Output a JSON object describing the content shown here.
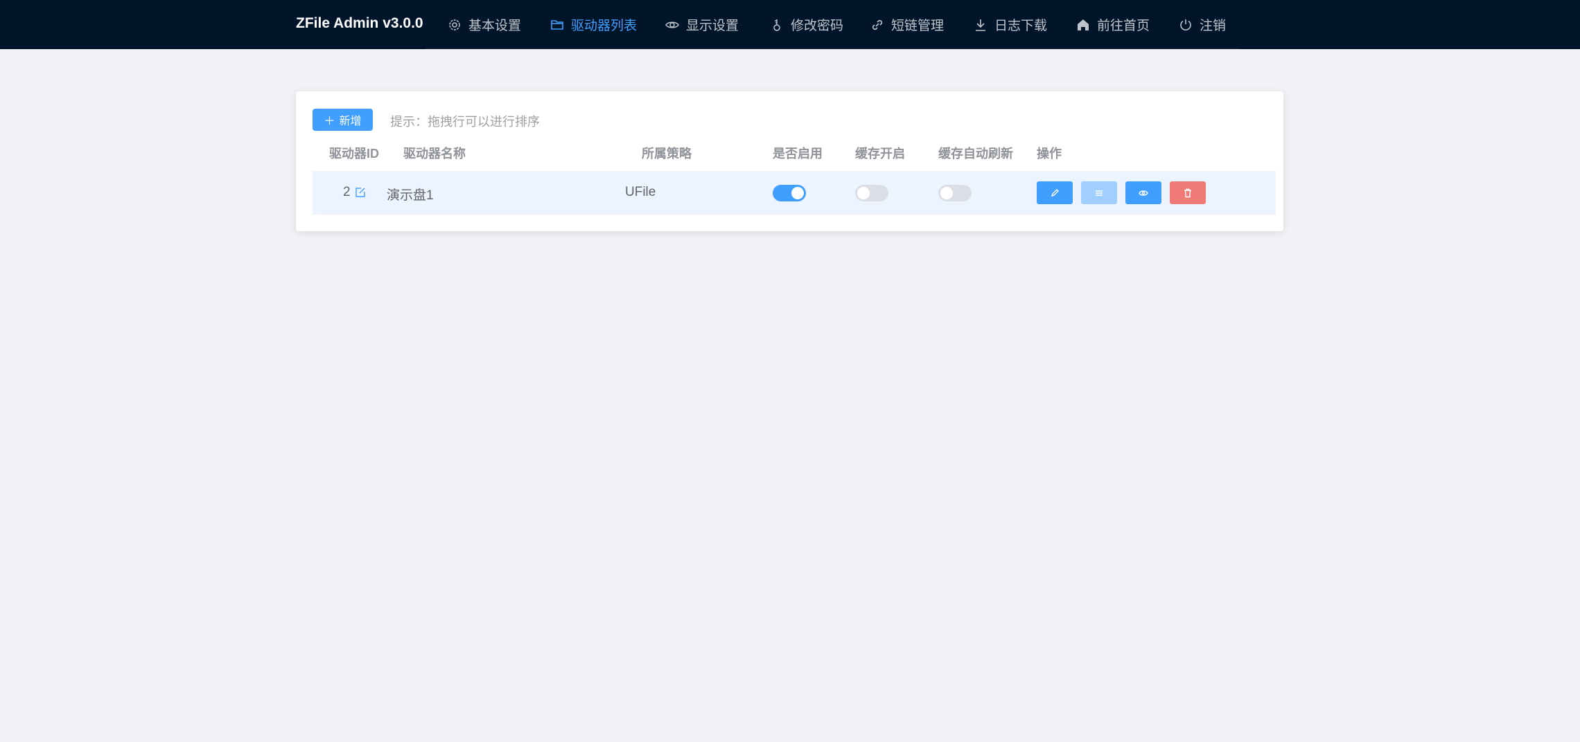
{
  "header": {
    "title": "ZFile Admin v3.0.0",
    "nav": [
      {
        "label": "基本设置",
        "icon": "gear-icon"
      },
      {
        "label": "驱动器列表",
        "icon": "folder-icon",
        "active": true
      },
      {
        "label": "显示设置",
        "icon": "eye-icon"
      },
      {
        "label": "修改密码",
        "icon": "key-icon"
      },
      {
        "label": "短链管理",
        "icon": "link-icon"
      },
      {
        "label": "日志下载",
        "icon": "download-icon"
      },
      {
        "label": "前往首页",
        "icon": "home-icon"
      },
      {
        "label": "注销",
        "icon": "power-icon"
      }
    ]
  },
  "toolbar": {
    "add_label": "新增",
    "hint": "提示：拖拽行可以进行排序"
  },
  "table": {
    "columns": [
      "驱动器ID",
      "驱动器名称",
      "所属策略",
      "是否启用",
      "缓存开启",
      "缓存自动刷新",
      "操作"
    ],
    "rows": [
      {
        "id": "2",
        "name": "演示盘1",
        "strategy": "UFile",
        "enabled": true,
        "cache": false,
        "auto_refresh": false
      }
    ]
  },
  "colors": {
    "primary": "#409eff",
    "light": "#a0cfff",
    "danger": "#f56c6c",
    "header_bg": "#001529"
  }
}
